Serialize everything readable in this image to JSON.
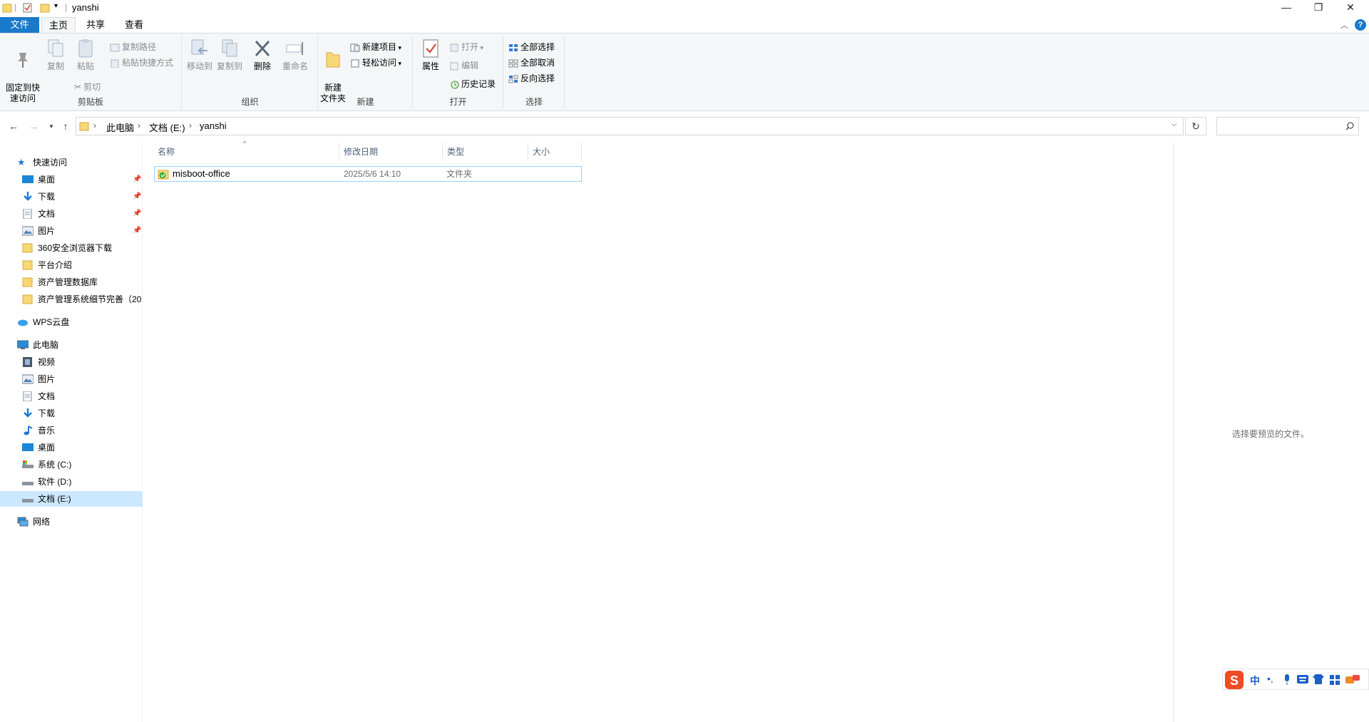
{
  "window": {
    "title": "yanshi",
    "controls": [
      "—",
      "❐",
      "✕"
    ]
  },
  "ribbon": {
    "tabs": [
      "文件",
      "主页",
      "共享",
      "查看"
    ],
    "clipboard": {
      "label": "剪贴板",
      "pin": "固定到快\n速访问",
      "copy": "复制",
      "paste": "粘贴",
      "copy_path": "复制路径",
      "paste_shortcut": "粘贴快捷方式",
      "cut": "剪切"
    },
    "organize": {
      "label": "组织",
      "move_to": "移动到",
      "copy_to": "复制到",
      "delete": "删除",
      "rename": "重命名"
    },
    "new": {
      "label": "新建",
      "new_folder": "新建\n文件夹",
      "new_item": "新建项目",
      "easy_access": "轻松访问"
    },
    "open": {
      "label": "打开",
      "properties": "属性",
      "open": "打开",
      "edit": "编辑",
      "history": "历史记录"
    },
    "select": {
      "label": "选择",
      "select_all": "全部选择",
      "select_none": "全部取消",
      "invert": "反向选择"
    }
  },
  "address": {
    "crumbs": [
      "此电脑",
      "文档 (E:)",
      "yanshi"
    ],
    "search_placeholder": ""
  },
  "nav": {
    "quick_access": "快速访问",
    "quick_items": [
      "桌面",
      "下载",
      "文档",
      "图片",
      "360安全浏览器下载",
      "平台介绍",
      "资产管理数据库",
      "资产管理系统细节完善（20"
    ],
    "wps": "WPS云盘",
    "this_pc": "此电脑",
    "pc_items": [
      "视频",
      "图片",
      "文档",
      "下载",
      "音乐",
      "桌面",
      "系统 (C:)",
      "软件 (D:)",
      "文档 (E:)"
    ],
    "network": "网络"
  },
  "columns": [
    "名称",
    "修改日期",
    "类型",
    "大小"
  ],
  "files": [
    {
      "name": "misboot-office",
      "date": "2025/5/6 14:10",
      "type": "文件夹",
      "size": ""
    }
  ],
  "preview": {
    "text": "选择要预览的文件。"
  },
  "ime": {
    "lang": "中"
  }
}
